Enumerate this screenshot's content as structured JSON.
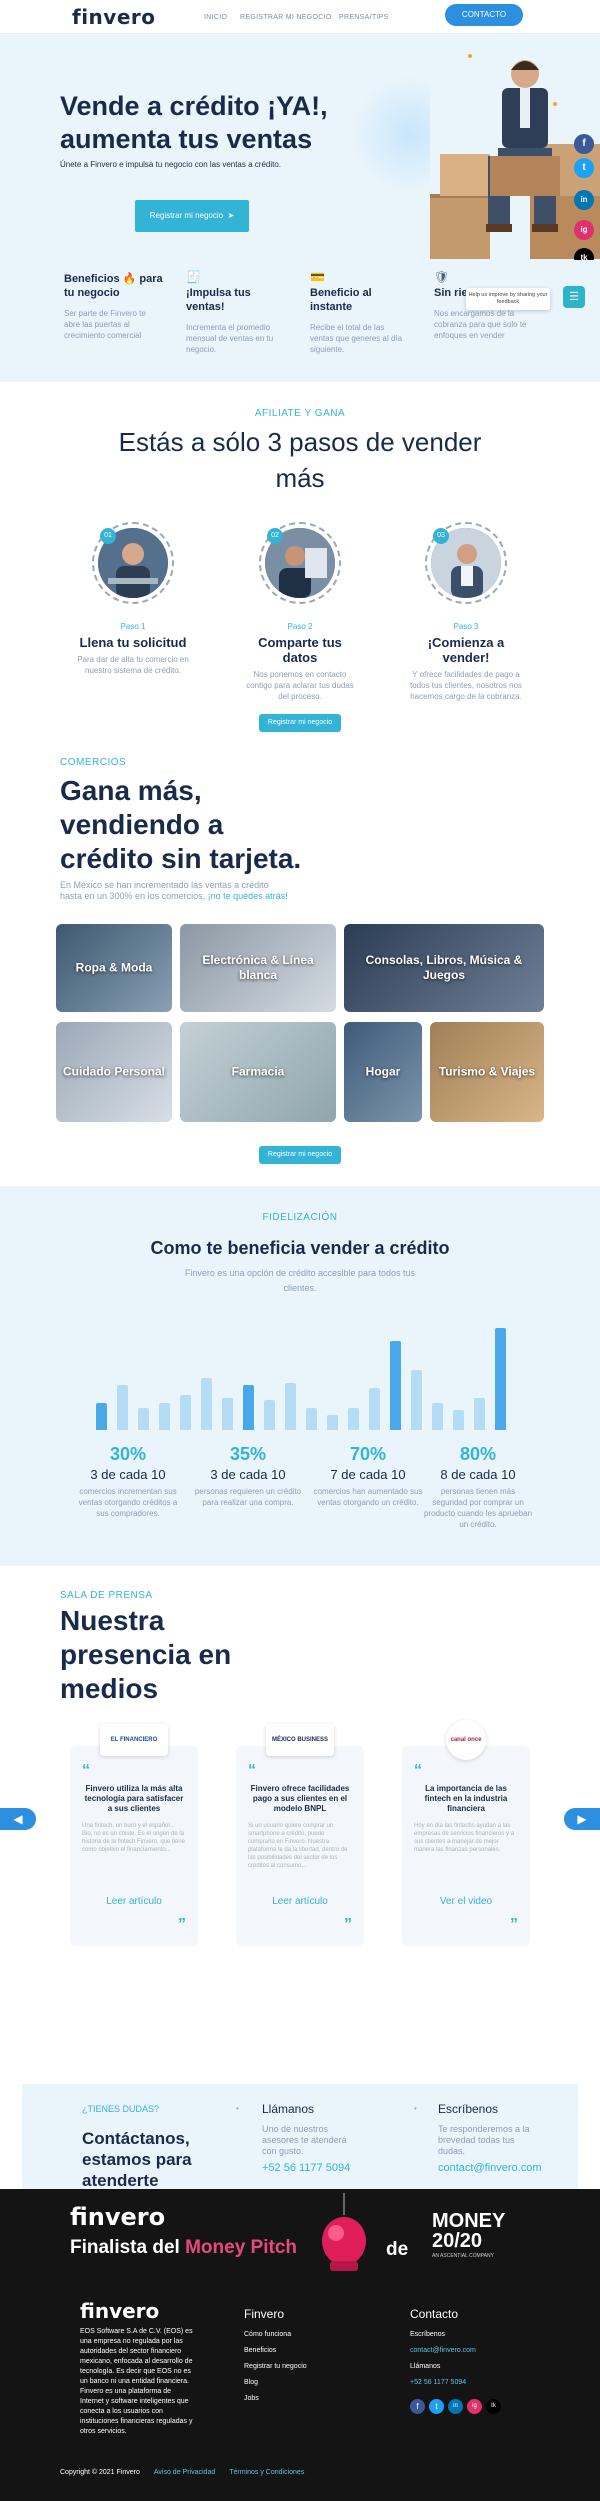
{
  "nav": {
    "logo": "finvero",
    "links": [
      "INICIO",
      "REGISTRAR MI NEGOCIO",
      "PRENSA/TIPS"
    ],
    "contact": "CONTACTO"
  },
  "hero": {
    "title": "Vende a crédito ¡YA!, aumenta tus ventas",
    "subtitle": "Únete a Finvero e impulsa tu negocio con las ventas a crédito.",
    "cta": "Registrar mi negocio"
  },
  "social": {
    "icons": [
      "f",
      "t",
      "in",
      "ig",
      "tk"
    ],
    "colors": [
      "#3b5998",
      "#1da1f2",
      "#0077b5",
      "#e1306c",
      "#000000"
    ]
  },
  "benefits": [
    {
      "title": "Beneficios 🔥 para tu negocio",
      "text": "Ser parte de Finvero te abre las puertas al crecimiento comercial",
      "icon": ""
    },
    {
      "title": "¡Impulsa tus ventas!",
      "text": "Incrementa el promedio mensual de ventas en tu negocio.",
      "icon": "receipt-icon"
    },
    {
      "title": "Beneficio al instante",
      "text": "Recibe el total de las ventas que generes al día siguiente.",
      "icon": "card-icon"
    },
    {
      "title": "Sin rie...",
      "text": "Nos encargamos de la cobranza para que solo te enfoques en vender",
      "icon": "shield-icon"
    }
  ],
  "feedback": {
    "tooltip": "Help us improve by sharing your feedback"
  },
  "steps": {
    "kicker": "AFILIATE Y GANA",
    "title": "Estás a sólo 3 pasos de vender más",
    "items": [
      {
        "num": "01",
        "paso": "Paso 1",
        "title": "Llena tu solicitud",
        "text": "Para dar de alta tu comercio en nuestro sistema de crédito."
      },
      {
        "num": "02",
        "paso": "Paso 2",
        "title": "Comparte tus datos",
        "text": "Nos ponemos en contacto contigo para aclarar tus dudas del proceso."
      },
      {
        "num": "03",
        "paso": "Paso 3",
        "title": "¡Comienza a vender!",
        "text": "Y ofrece facilidades de pago a todos tus clientes, nosotros nos hacemos cargo de la cobranza."
      }
    ],
    "cta": "Registrar mi negocio"
  },
  "comercios": {
    "kicker": "COMERCIOS",
    "title": "Gana más, vendiendo a crédito sin tarjeta.",
    "text": "En México se han incrementado las ventas a crédito hasta en un 300% en los comercios,",
    "text_link": "¡no te quedes atrás!",
    "tiles": [
      "Ropa & Moda",
      "Electrónica & Línea blanca",
      "Consolas, Libros, Música & Juegos",
      "Cuidado Personal",
      "Farmacia",
      "Hogar",
      "Turismo & Viajes"
    ],
    "cta": "Registrar mi negocio"
  },
  "fidelizacion": {
    "kicker": "FIDELIZACIÓN",
    "title": "Como te beneficia vender a crédito",
    "subtitle": "Finvero es una opción de crédito accesible para todos tus clientes.",
    "bars": [
      0.22,
      0.36,
      0.18,
      0.22,
      0.28,
      0.42,
      0.26,
      0.36,
      0.24,
      0.38,
      0.18,
      0.12,
      0.18,
      0.34,
      0.72,
      0.48,
      0.22,
      0.16,
      0.26,
      0.82
    ],
    "highlight": [
      1,
      0,
      0,
      0,
      0,
      0,
      0,
      1,
      0,
      0,
      0,
      0,
      0,
      0,
      1,
      0,
      0,
      0,
      0,
      1
    ],
    "stats": [
      {
        "pct": "30%",
        "de": "3 de cada 10",
        "text": "comercios incrementan sus ventas otorgando créditos a sus compradores."
      },
      {
        "pct": "35%",
        "de": "3 de cada 10",
        "text": "personas requieren un crédito para realizar una compra."
      },
      {
        "pct": "70%",
        "de": "7 de cada 10",
        "text": "comercios han aumentado sus ventas otorgando un crédito."
      },
      {
        "pct": "80%",
        "de": "8 de cada 10",
        "text": "personas tienen más seguridad por comprar un producto cuando les aprueban un crédito."
      }
    ]
  },
  "prensa": {
    "kicker": "SALA DE PRENSA",
    "title": "Nuestra presencia en medios",
    "cards": [
      {
        "logo": "EL FINANCIERO",
        "title": "Finvero utiliza la más alta tecnología para satisfacer a sus clientes",
        "text": "Una fintech, un buró y el español... Bio, no es un chiste. Es el origen de la historia de la fintech Finvero, que tiene como objetivo el financiamiento...",
        "link": "Leer artículo"
      },
      {
        "logo": "MÉXICO BUSINESS",
        "title": "Finvero ofrece facilidades pago a sus clientes en el modelo BNPL",
        "text": "Si un usuario quiere comprar un smartphone a crédito, puede comprarlo en Finvero. Nuestra plataforma le da la libertad, dentro de las posibilidades del sector de los créditos al consumo...",
        "link": "Leer artículo"
      },
      {
        "logo": "canal once",
        "title": "La importancia de las fintech en la industria financiera",
        "text": "Hoy en día las fintechs ayudan a las empresas de servicios financieros y a sus clientes a manejar de mejor manera las finanzas personales.",
        "link": "Ver el video"
      }
    ]
  },
  "contact": {
    "kicker": "¿TIENES DUDAS?",
    "title": "Contáctanos, estamos para atenderte",
    "call_title": "Llámanos",
    "call_text": "Uno de nuestros asesores te atenderá con gusto.",
    "phone": "+52 56 1177 5094",
    "mail_title": "Escríbenos",
    "mail_text": "Te responderemos a la brevedad todas tus dudas.",
    "email": "contact@finvero.com"
  },
  "money": {
    "logo": "finvero",
    "line": "Finalista del",
    "highlight": "Money Pitch",
    "de": "de",
    "brand": "MONEY 20/20",
    "tag": "AN ASCENTIAL COMPANY"
  },
  "footer": {
    "logo": "finvero",
    "about": "EOS Software S.A de C.V. (EOS) es una empresa no regulada por las autoridades del sector financiero mexicano, enfocada al desarrollo de tecnología. Es decir que EOS no es un banco ni una entidad financiera. Finvero es una plataforma de Internet y software inteligentes que conecta a los usuarios con instituciones financieras reguladas y otros servicios.",
    "col1_title": "Finvero",
    "col1": [
      "Cómo funciona",
      "Beneficios",
      "Registrar tu negocio",
      "Blog",
      "Jobs"
    ],
    "col2_title": "Contacto",
    "col2": [
      "Escríbenos",
      "contact@finvero.com",
      "Llámanos",
      "+52 56 1177 5094"
    ],
    "copyright": "Copyright © 2021 Finvero",
    "privacy": "Aviso de Privacidad",
    "terms": "Términos y Condiciones"
  }
}
